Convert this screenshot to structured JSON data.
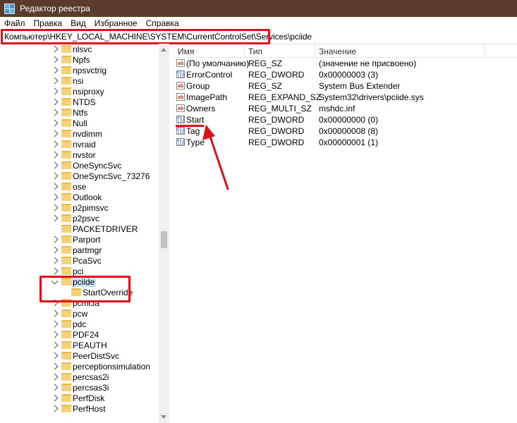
{
  "window": {
    "title": "Редактор реестра"
  },
  "menu": [
    "Файл",
    "Правка",
    "Вид",
    "Избранное",
    "Справка"
  ],
  "address": "Компьютер\\HKEY_LOCAL_MACHINE\\SYSTEM\\CurrentControlSet\\Services\\pciide",
  "tree": {
    "items": [
      {
        "label": "nlsvc"
      },
      {
        "label": "Npfs"
      },
      {
        "label": "npsvctrig"
      },
      {
        "label": "nsi"
      },
      {
        "label": "nsiproxy"
      },
      {
        "label": "NTDS"
      },
      {
        "label": "Ntfs"
      },
      {
        "label": "Null"
      },
      {
        "label": "nvdimm"
      },
      {
        "label": "nvraid"
      },
      {
        "label": "nvstor"
      },
      {
        "label": "OneSyncSvc"
      },
      {
        "label": "OneSyncSvc_73276"
      },
      {
        "label": "ose"
      },
      {
        "label": "Outlook"
      },
      {
        "label": "p2pimsvc"
      },
      {
        "label": "p2psvc"
      },
      {
        "label": "PACKETDRIVER"
      },
      {
        "label": "Parport"
      },
      {
        "label": "partmgr"
      },
      {
        "label": "PcaSvc"
      },
      {
        "label": "pci"
      },
      {
        "label": "pciide"
      },
      {
        "label": "StartOverride"
      },
      {
        "label": "pcmcia"
      },
      {
        "label": "pcw"
      },
      {
        "label": "pdc"
      },
      {
        "label": "PDF24"
      },
      {
        "label": "PEAUTH"
      },
      {
        "label": "PeerDistSvc"
      },
      {
        "label": "perceptionsimulation"
      },
      {
        "label": "percsas2i"
      },
      {
        "label": "percsas3i"
      },
      {
        "label": "PerfDisk"
      },
      {
        "label": "PerfHost"
      }
    ]
  },
  "columns": {
    "name": "Имя",
    "type": "Тип",
    "data": "Значение"
  },
  "values": [
    {
      "icon": "string-value-icon",
      "name": "(По умолчанию)",
      "type": "REG_SZ",
      "data": "(значение не присвоено)"
    },
    {
      "icon": "binary-value-icon",
      "name": "ErrorControl",
      "type": "REG_DWORD",
      "data": "0x00000003 (3)"
    },
    {
      "icon": "string-value-icon",
      "name": "Group",
      "type": "REG_SZ",
      "data": "System Bus Extender"
    },
    {
      "icon": "string-value-icon",
      "name": "ImagePath",
      "type": "REG_EXPAND_SZ",
      "data": "System32\\drivers\\pciide.sys"
    },
    {
      "icon": "string-value-icon",
      "name": "Owners",
      "type": "REG_MULTI_SZ",
      "data": "mshdc.inf"
    },
    {
      "icon": "binary-value-icon",
      "name": "Start",
      "type": "REG_DWORD",
      "data": "0x00000000 (0)"
    },
    {
      "icon": "binary-value-icon",
      "name": "Tag",
      "type": "REG_DWORD",
      "data": "0x00000008 (8)"
    },
    {
      "icon": "binary-value-icon",
      "name": "Type",
      "type": "REG_DWORD",
      "data": "0x00000001 (1)"
    }
  ],
  "colors": {
    "titlebar": "#5a3b2c",
    "highlight": "#e0101a",
    "selection": "#cce4f7",
    "folder": "#f3d27a"
  }
}
